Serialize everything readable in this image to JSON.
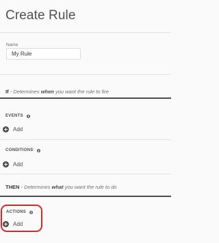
{
  "page": {
    "title": "Create Rule"
  },
  "name_field": {
    "label": "Name",
    "value": "My Rule"
  },
  "if_section": {
    "key": "If",
    "desc_pre": " - Determines ",
    "desc_emph": "when",
    "desc_post": " you want the rule to fire"
  },
  "events": {
    "label": "EVENTS",
    "add_label": "Add"
  },
  "conditions": {
    "label": "CONDITIONS",
    "add_label": "Add"
  },
  "then_section": {
    "key": "THEN",
    "desc_pre": " - Determines ",
    "desc_emph": "what",
    "desc_post": " you want the rule to do"
  },
  "actions": {
    "label": "ACTIONS",
    "add_label": "Add"
  },
  "colors": {
    "highlight": "#e8202a",
    "text": "#4b4b4b"
  }
}
